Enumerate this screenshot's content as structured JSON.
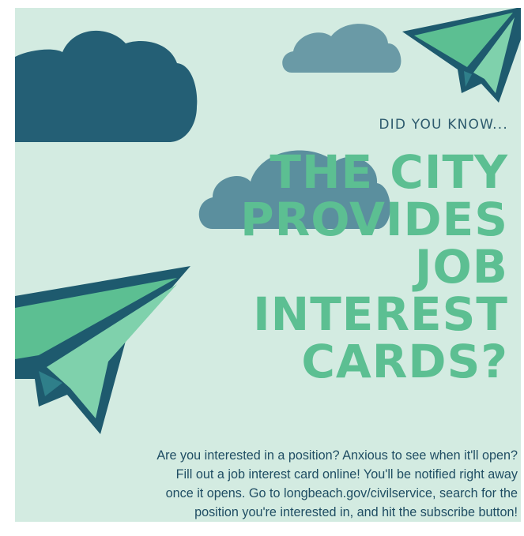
{
  "poster": {
    "kicker": "DID YOU KNOW...",
    "headline_lines": [
      "THE CITY",
      "PROVIDES",
      "JOB",
      "INTEREST",
      "CARDS?"
    ],
    "body_lines": [
      "Are you interested in a position? Anxious to see when it'll open?",
      "Fill out a job interest card online! You'll be notified right away",
      "once it opens. Go to longbeach.gov/civilservice, search for the",
      "position you're interested in, and hit the subscribe button!"
    ]
  },
  "colors": {
    "background": "#d3ebe1",
    "navy_cloud": "#245f75",
    "slate_cloud": "#6a9aa6",
    "headline_green": "#5cbf92",
    "plane_dark": "#1e5a6e",
    "plane_light": "#5cbf92"
  }
}
